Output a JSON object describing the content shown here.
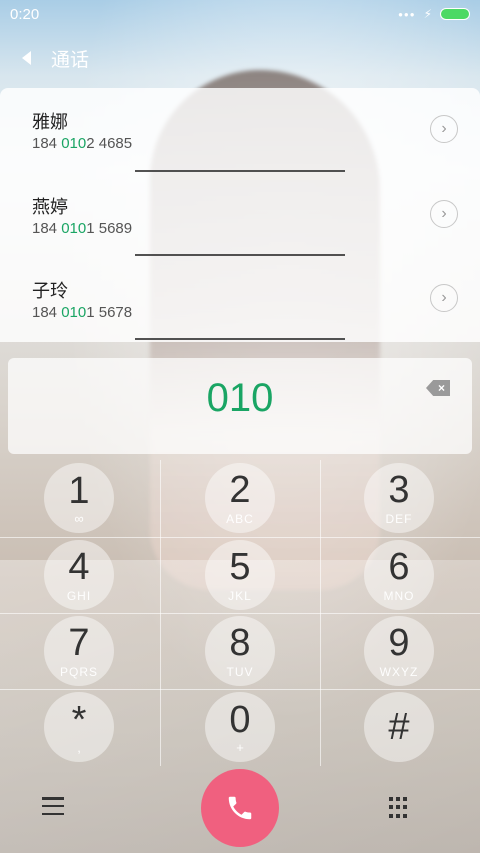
{
  "status_bar": {
    "time": "0:20"
  },
  "header": {
    "title": "通话"
  },
  "contacts": [
    {
      "name": "雅娜",
      "number_prefix": "184 ",
      "number_match": "010",
      "number_rest": "2 4685"
    },
    {
      "name": "燕婷",
      "number_prefix": "184 ",
      "number_match": "010",
      "number_rest": "1 5689"
    },
    {
      "name": "子玲",
      "number_prefix": "184 ",
      "number_match": "010",
      "number_rest": "1 5678"
    }
  ],
  "dialer": {
    "entered_digits": "010"
  },
  "keypad": {
    "keys": [
      {
        "digit": "1",
        "sub": "voicemail-icon"
      },
      {
        "digit": "2",
        "sub": "ABC"
      },
      {
        "digit": "3",
        "sub": "DEF"
      },
      {
        "digit": "4",
        "sub": "GHI"
      },
      {
        "digit": "5",
        "sub": "JKL"
      },
      {
        "digit": "6",
        "sub": "MNO"
      },
      {
        "digit": "7",
        "sub": "PQRS"
      },
      {
        "digit": "8",
        "sub": "TUV"
      },
      {
        "digit": "9",
        "sub": "WXYZ"
      },
      {
        "digit": "*",
        "sub": ","
      },
      {
        "digit": "0",
        "sub": "+"
      },
      {
        "digit": "#",
        "sub": ""
      }
    ]
  },
  "colors": {
    "accent": "#1aa564",
    "call_button": "#f0607f"
  },
  "icons": {
    "back": "back-arrow-icon",
    "backspace": "backspace-icon",
    "menu": "menu-icon",
    "call": "phone-icon",
    "dialpad": "dialpad-icon"
  }
}
